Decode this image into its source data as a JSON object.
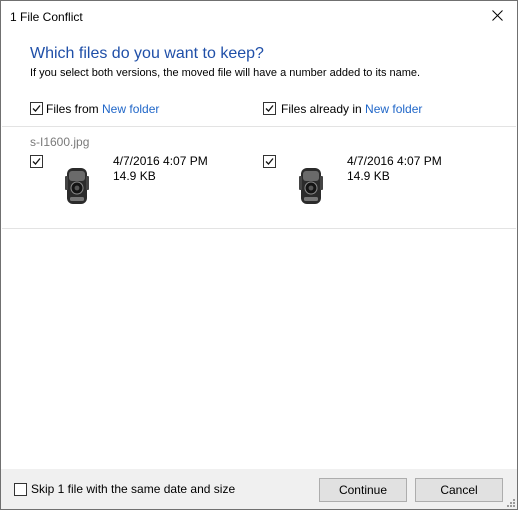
{
  "window": {
    "title": "1 File Conflict"
  },
  "header": {
    "question": "Which files do you want to keep?",
    "explanation": "If you select both versions, the moved file will have a number added to its name."
  },
  "columns": {
    "left": {
      "prefix": "Files from ",
      "folder": "New folder",
      "checked": true
    },
    "right": {
      "prefix": "Files already in ",
      "folder": "New folder",
      "checked": true
    }
  },
  "conflict": {
    "filename": "s-I1600.jpg",
    "left": {
      "date": "4/7/2016 4:07 PM",
      "size": "14.9 KB",
      "checked": true,
      "thumbnail_icon": "camera-thumbnail-icon"
    },
    "right": {
      "date": "4/7/2016 4:07 PM",
      "size": "14.9 KB",
      "checked": true,
      "thumbnail_icon": "camera-thumbnail-icon"
    }
  },
  "footer": {
    "skip_label": "Skip 1 file with the same date and size",
    "skip_checked": false,
    "continue_label": "Continue",
    "cancel_label": "Cancel"
  },
  "colors": {
    "heading": "#1f4fa8",
    "link": "#1f66c8",
    "footer_bg": "#f0f0f0"
  }
}
